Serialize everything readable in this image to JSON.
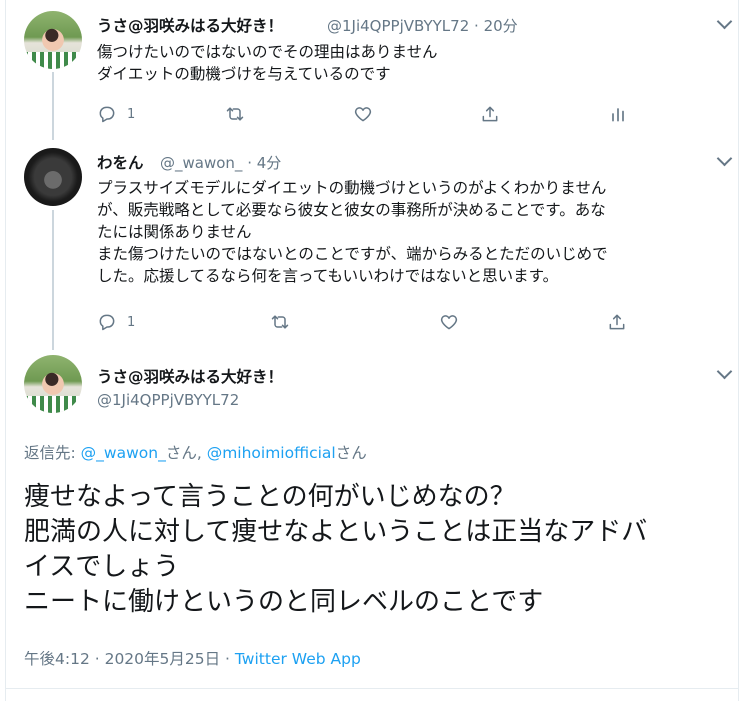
{
  "tweets": [
    {
      "display_name": "うさ@羽咲みはる大好き！",
      "handle": "@1Ji4QPPjVBYYL72",
      "separator": "·",
      "time": "20分",
      "lines": [
        "傷つけたいのではないのでその理由はありません",
        "ダイエットの動機づけを与えているのです"
      ],
      "reply_count": "1",
      "avatar": "profile-photo-woman"
    },
    {
      "display_name": "わをん",
      "handle": "@_wawon_",
      "separator": "·",
      "time": "4分",
      "lines": [
        "プラスサイズモデルにダイエットの動機づけというのがよくわかりません",
        "が、販売戦略として必要なら彼女と彼女の事務所が決めることです。あな",
        "たには関係ありません",
        "また傷つけたいのではないとのことですが、端からみるとただのいじめで",
        "した。応援してるなら何を言ってもいいわけではないと思います。"
      ],
      "reply_count": "1",
      "avatar": "lion-photo"
    }
  ],
  "main_tweet": {
    "display_name": "うさ@羽咲みはる大好き！",
    "handle": "@1Ji4QPPjVBYYL72",
    "reply_prefix": "返信先: ",
    "reply_user1": "@_wawon_",
    "reply_san1": "さん, ",
    "reply_user2": "@mihoimiofficial",
    "reply_san2": "さん",
    "lines": [
      "痩せなよって言うことの何がいじめなの？",
      "肥満の人に対して痩せなよということは正当なアドバ",
      "イスでしょう",
      "ニートに働けというのと同レベルのことです"
    ],
    "timestamp": "午後4:12 · 2020年5月25日 · ",
    "source": "Twitter Web App"
  },
  "colors": {
    "link": "#1da1f2",
    "secondary_text": "#657786",
    "divider": "#e6ecf0",
    "thread_line": "#ccd6dd"
  },
  "icons": [
    "reply-icon",
    "retweet-icon",
    "like-icon",
    "share-icon",
    "analytics-icon",
    "chevron-down-icon"
  ]
}
